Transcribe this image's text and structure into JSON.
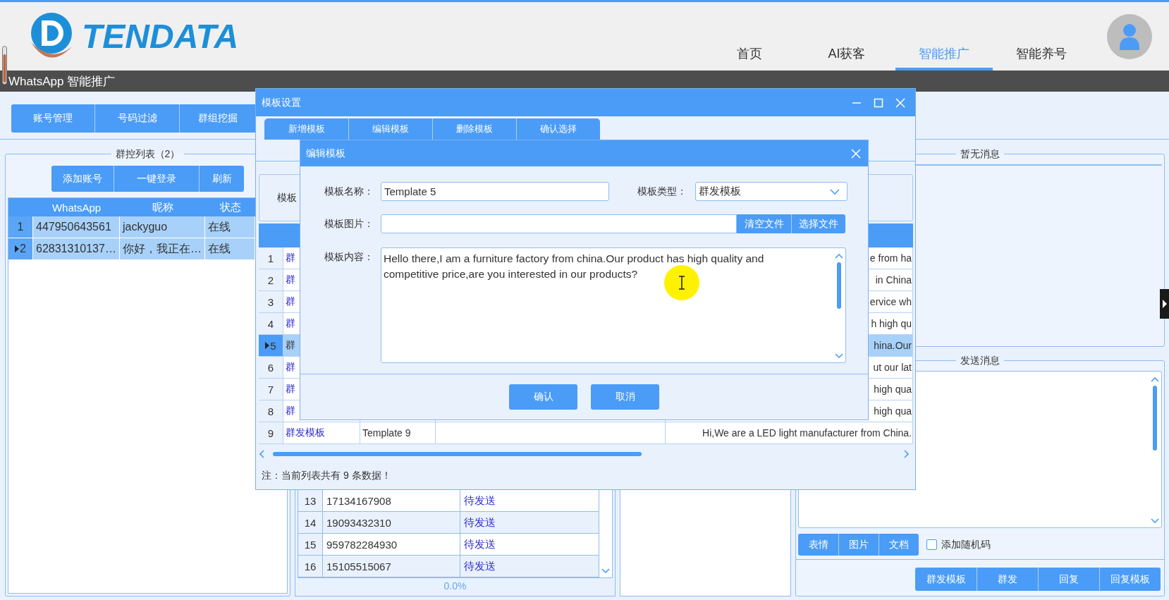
{
  "header": {
    "logo_text": "TENDATA",
    "nav": [
      {
        "label": "首页",
        "selected": false
      },
      {
        "label": "AI获客",
        "selected": false
      },
      {
        "label": "智能推广",
        "selected": true
      },
      {
        "label": "智能养号",
        "selected": false
      }
    ]
  },
  "page_title": "WhatsApp 智能推广",
  "toolbar": {
    "buttons": [
      "账号管理",
      "号码过滤",
      "群组挖掘"
    ]
  },
  "account_panel": {
    "title": "群控列表（2）",
    "buttons": [
      "添加账号",
      "一键登录",
      "刷新"
    ],
    "columns": [
      "WhatsApp",
      "昵称",
      "状态"
    ],
    "rows": [
      {
        "index": "1",
        "number": "447950643561",
        "nickname": "jackyguo",
        "status": "在线",
        "selected": true,
        "current": false
      },
      {
        "index": "2",
        "number": "62831310137…",
        "nickname": "你好，我正在…",
        "status": "在线",
        "selected": true,
        "current": true
      }
    ]
  },
  "number_panel": {
    "rows": [
      {
        "index": "13",
        "number": "17134167908",
        "status": "待发送"
      },
      {
        "index": "14",
        "number": "19093432310",
        "status": "待发送"
      },
      {
        "index": "15",
        "number": "959782284930",
        "status": "待发送"
      },
      {
        "index": "16",
        "number": "15105515067",
        "status": "待发送"
      }
    ],
    "progress_text": "0.0%"
  },
  "message_panel": {
    "title": "暂无消息"
  },
  "send_panel": {
    "title": "发送消息",
    "media_buttons": [
      "表情",
      "图片",
      "文档"
    ],
    "random_code": {
      "label": "添加随机码",
      "checked": false
    },
    "action_buttons": [
      "群发模板",
      "群发",
      "回复",
      "回复模板"
    ]
  },
  "template_dialog": {
    "title": "模板设置",
    "actions": [
      "新增模板",
      "编辑模板",
      "删除模板",
      "确认选择"
    ],
    "filter_label": "模板",
    "rows": [
      {
        "index": "1",
        "type": "群",
        "content": "e from ha",
        "selected": false,
        "current": false
      },
      {
        "index": "2",
        "type": "群",
        "content": "in China",
        "selected": false,
        "current": false
      },
      {
        "index": "3",
        "type": "群",
        "content": "ervice wh",
        "selected": false,
        "current": false
      },
      {
        "index": "4",
        "type": "群",
        "content": "h high qu",
        "selected": false,
        "current": false
      },
      {
        "index": "5",
        "type": "群",
        "content": "hina.Our",
        "selected": true,
        "current": true
      },
      {
        "index": "6",
        "type": "群",
        "content": "ut our lat",
        "selected": false,
        "current": false
      },
      {
        "index": "7",
        "type": "群",
        "content": "high qua",
        "selected": false,
        "current": false
      },
      {
        "index": "8",
        "type": "群",
        "content": "high qua",
        "selected": false,
        "current": false
      },
      {
        "index": "9",
        "type": "群发模板",
        "name": "Template 9",
        "content": "Hi,We are a LED light manufacturer from China.",
        "selected": false,
        "current": false
      }
    ],
    "footer": "注：当前列表共有 9 条数据！"
  },
  "edit_dialog": {
    "title": "编辑模板",
    "name": {
      "label": "模板名称：",
      "value": "Template 5"
    },
    "type": {
      "label": "模板类型：",
      "value": "群发模板"
    },
    "image": {
      "label": "模板图片：",
      "buttons": [
        "清空文件",
        "选择文件"
      ]
    },
    "content": {
      "label": "模板内容：",
      "value": "Hello there,I am a furniture factory from china.Our product has high quality and competitive price,are you interested in our products?"
    },
    "buttons": [
      "确认",
      "取消"
    ]
  }
}
